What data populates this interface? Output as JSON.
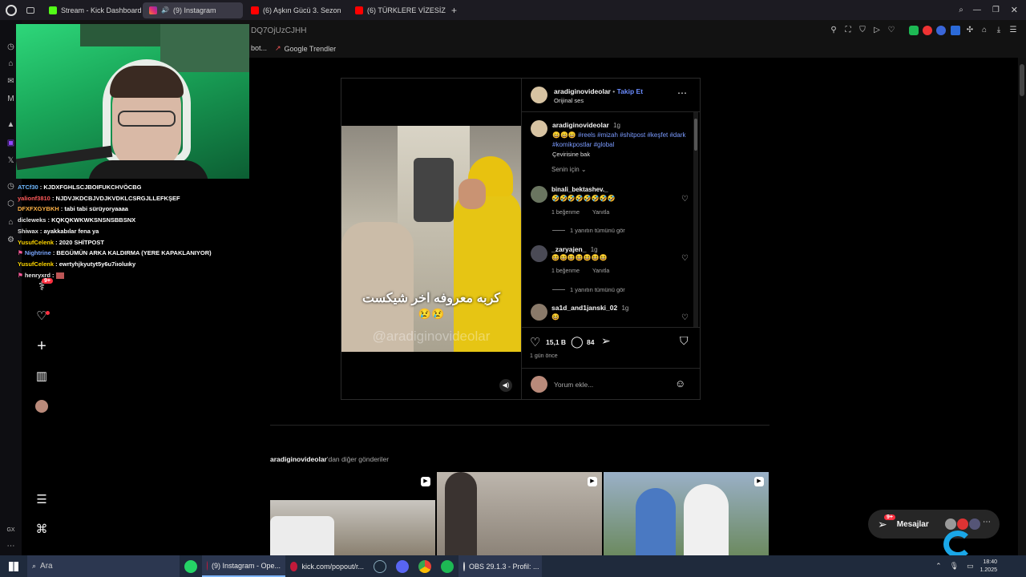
{
  "browser": {
    "tabs": [
      {
        "label": "Stream - Kick Dashboard",
        "color": "#53fc18",
        "active": false
      },
      {
        "label": "(9) Instagram",
        "color": "#e1306c",
        "active": true
      },
      {
        "label": "(6) Aşkın Gücü 3. Sezon",
        "color": "#ff0000",
        "active": false
      },
      {
        "label": "(6) TÜRKLERE VİZESİZ O",
        "color": "#ff0000",
        "active": false
      }
    ],
    "new_tab": "+",
    "address_fragment": "DQ7OjUzCJHH",
    "bookmarks": {
      "partial": "bot...",
      "trends": "Google Trendler"
    }
  },
  "chat": [
    {
      "user": "ATCf30",
      "msg": "KJDXFGHLSCJBOIFUKCHVÖCBG",
      "color": "#6fb8ff"
    },
    {
      "user": "yalionf3810",
      "msg": "NJDVJKDCBJVDJKVDKLCSRGJLLEFKŞEF",
      "color": "#ff5a5a"
    },
    {
      "user": "DFXFXGYBKH",
      "msg": "tabi tabi sürüyoryaaaa",
      "color": "#ffb347"
    },
    {
      "user": "dicleweks",
      "msg": "KQKQKWKWKSNSNSBBSNX",
      "color": "#e8e8e8"
    },
    {
      "user": "Shiwax",
      "msg": "ayakkabılar fena ya",
      "color": "#e8e8e8"
    },
    {
      "user": "YusufCelenk",
      "msg": "2020 SHİTPOST",
      "color": "#ffd700"
    },
    {
      "user": "Nightrine",
      "msg": "BEGÜMÜN ARKA KALDIRMA (YERE KAPAKLANIYOR)",
      "color": "#7aa7ff"
    },
    {
      "user": "YusufCelenk",
      "msg": "ewrtyhjkyutyt5y6u7iıoluıky",
      "color": "#ffd700"
    },
    {
      "user": "henryxrd",
      "msg": "",
      "color": "#e8e8e8"
    }
  ],
  "ig_nav": {
    "notif_badge": "9+"
  },
  "post": {
    "author": "aradiginovideolar",
    "follow": "Takip Et",
    "audio": "Orijinal ses",
    "caption_age": "1g",
    "caption_emojis": "😄😄😄",
    "hashtags": [
      "#reels",
      "#mizah",
      "#shitpost",
      "#keşfet",
      "#dark",
      "#komikpostlar",
      "#global"
    ],
    "translate": "Çevirisine bak",
    "sort": "Senin için",
    "overlay_text": "كربه معروفه اخر شيكست",
    "overlay_emojis": "😢😢",
    "watermark": "@aradiginovideolar",
    "comments": [
      {
        "user": "binali_bektashev._",
        "age": "1g",
        "text": "🤣🤣🤣🤣🤣🤣🤣🤣",
        "likes": "1 beğenme",
        "reply": "Yanıtla",
        "view": "1 yanıtın tümünü gör"
      },
      {
        "user": "_zaryajen_",
        "age": "1g",
        "text": "😆😆😆😆😆😆😆",
        "likes": "1 beğenme",
        "reply": "Yanıtla",
        "view": "1 yanıtın tümünü gör"
      },
      {
        "user": "sa1d_and1janski_02",
        "age": "1g",
        "text": "😆"
      }
    ],
    "like_count": "15,1 B",
    "comment_count": "84",
    "posted": "1 gün önce",
    "add_comment": "Yorum ekle..."
  },
  "more_posts": {
    "user": "aradiginovideolar",
    "suffix": "'dan diğer gönderiler"
  },
  "messages": {
    "label": "Mesajlar",
    "badge": "9+"
  },
  "taskbar": {
    "search": "Ara",
    "items": [
      "(9) Instagram - Ope...",
      "kick.com/popout/r...",
      "OBS 29.1.3 - Profil: ..."
    ],
    "time": "18:40",
    "date": "1.2025"
  },
  "icons": {
    "like": "heart-icon",
    "comment": "comment-icon",
    "share": "send-icon",
    "save": "bookmark-icon"
  }
}
